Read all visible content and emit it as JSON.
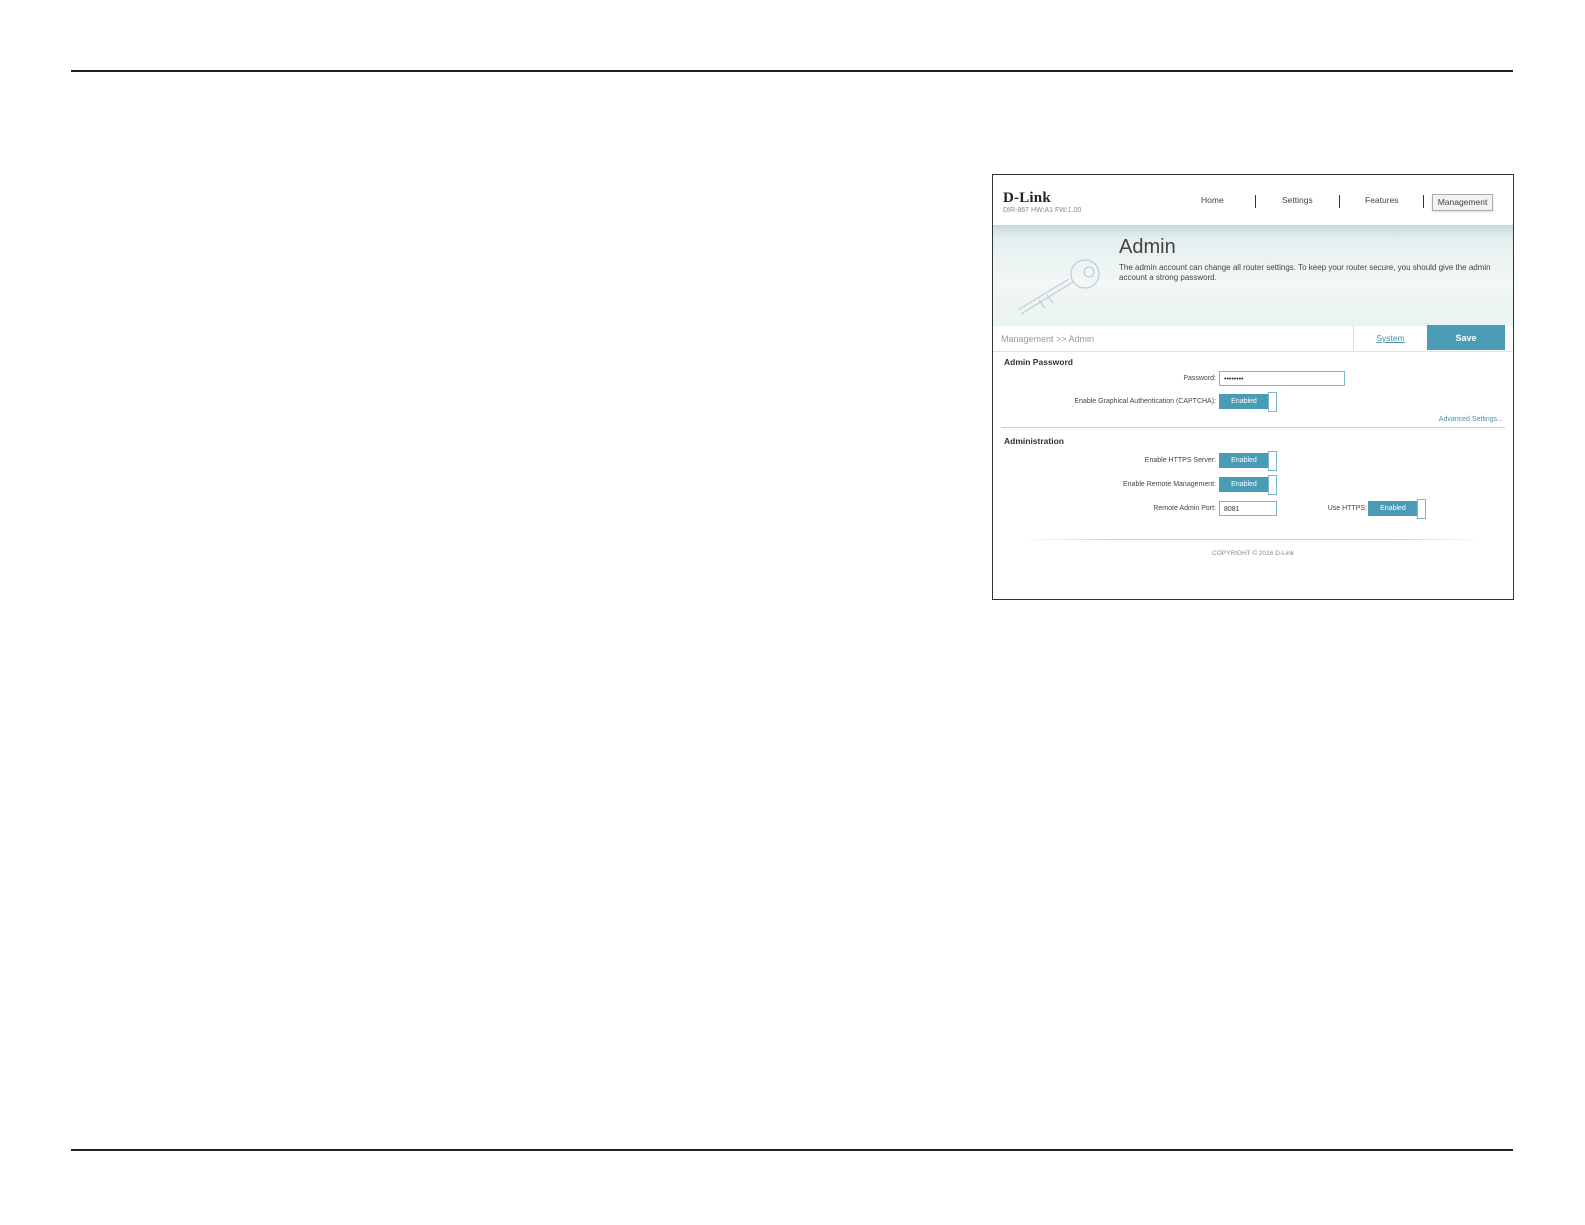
{
  "router": {
    "logo": "D-Link",
    "model": "DIR-867 HW:A1 FW:1.00",
    "nav": {
      "home": "Home",
      "settings": "Settings",
      "features": "Features",
      "management": "Management"
    },
    "banner": {
      "title": "Admin",
      "description": "The admin account can change all router settings. To keep your router secure, you should give the admin account a strong password."
    },
    "breadcrumb": "Management >> Admin",
    "system_link": "System",
    "save_label": "Save",
    "admin_password": {
      "title": "Admin Password",
      "password_label": "Password:",
      "password_value": "••••••••",
      "captcha_label": "Enable Graphical Authentication (CAPTCHA):",
      "captcha_state": "Enabled",
      "advanced_link": "Advanced Settings..."
    },
    "administration": {
      "title": "Administration",
      "https_label": "Enable HTTPS Server:",
      "https_state": "Enabled",
      "remote_label": "Enable Remote Management:",
      "remote_state": "Enabled",
      "port_label": "Remote Admin Port:",
      "port_value": "8081",
      "use_https_label": "Use HTTPS:",
      "use_https_state": "Enabled"
    },
    "copyright": "COPYRIGHT © 2016 D-Link"
  }
}
